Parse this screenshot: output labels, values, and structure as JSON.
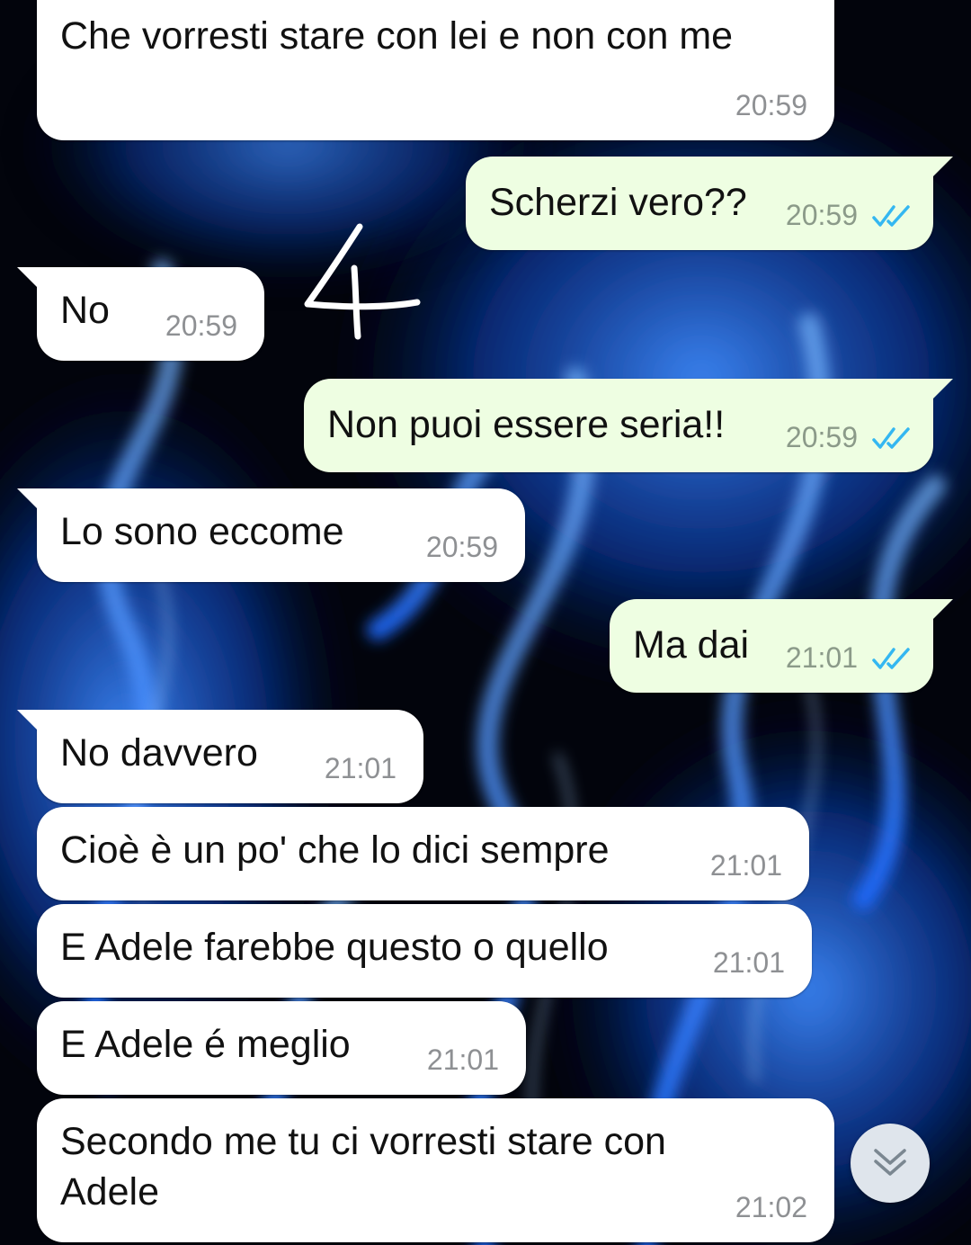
{
  "conversation": {
    "messages": [
      {
        "direction": "in",
        "text": "Che vorresti stare con lei e non con me",
        "time": "20:59"
      },
      {
        "direction": "out",
        "text": "Scherzi vero??",
        "time": "20:59",
        "status": "read"
      },
      {
        "direction": "in",
        "text": "No",
        "time": "20:59"
      },
      {
        "direction": "out",
        "text": "Non puoi essere seria!!",
        "time": "20:59",
        "status": "read"
      },
      {
        "direction": "in",
        "text": "Lo sono eccome",
        "time": "20:59"
      },
      {
        "direction": "out",
        "text": "Ma dai",
        "time": "21:01",
        "status": "read"
      },
      {
        "direction": "in",
        "text": "No davvero",
        "time": "21:01"
      },
      {
        "direction": "in",
        "text": "Cioè è un po' che lo dici sempre",
        "time": "21:01"
      },
      {
        "direction": "in",
        "text": "E Adele farebbe questo o quello",
        "time": "21:01"
      },
      {
        "direction": "in",
        "text": "E Adele é meglio",
        "time": "21:01"
      },
      {
        "direction": "in",
        "text": "Secondo me tu ci vorresti stare con\nAdele",
        "time": "21:02"
      }
    ]
  },
  "annotation": {
    "text": "4"
  },
  "colors": {
    "incoming_bubble": "#ffffff",
    "outgoing_bubble": "#eefee2",
    "read_ticks": "#34b7f1",
    "wallpaper": "blue flames on black"
  },
  "icons": {
    "read_receipt": "double-check-icon",
    "scroll_down": "double-chevron-down-icon"
  }
}
